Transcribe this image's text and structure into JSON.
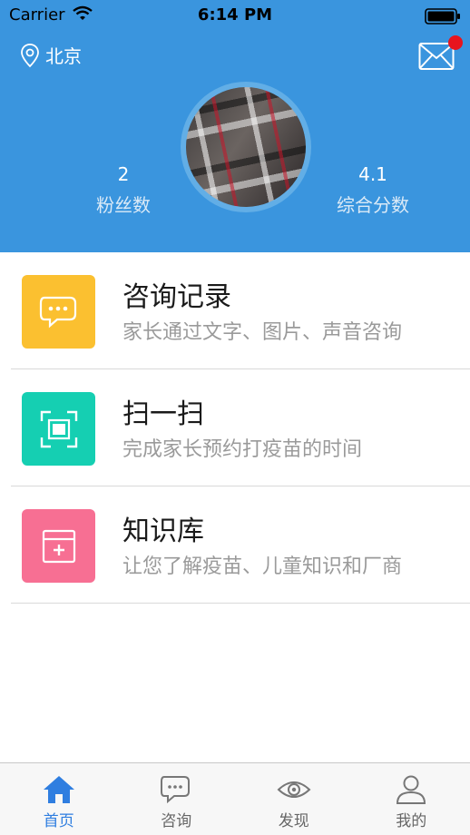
{
  "status_bar": {
    "carrier": "Carrier",
    "time": "6:14 PM"
  },
  "header": {
    "location": "北京",
    "stats": [
      {
        "value": "2",
        "label": "粉丝数"
      },
      {
        "value": "4.1",
        "label": "综合分数"
      }
    ]
  },
  "colors": {
    "header_bg": "#3a95de",
    "consult": "#fbc030",
    "scan": "#15cfb2",
    "knowledge": "#f76f93",
    "tab_active": "#2f7ee0"
  },
  "menu": [
    {
      "title": "咨询记录",
      "desc": "家长通过文字、图片、声音咨询",
      "icon": "chat-bubbles-icon"
    },
    {
      "title": "扫一扫",
      "desc": "完成家长预约打疫苗的时间",
      "icon": "scan-icon"
    },
    {
      "title": "知识库",
      "desc": "让您了解疫苗、儿童知识和厂商",
      "icon": "calendar-plus-icon"
    }
  ],
  "tabs": [
    {
      "label": "首页",
      "icon": "home-icon"
    },
    {
      "label": "咨询",
      "icon": "chat-icon"
    },
    {
      "label": "发现",
      "icon": "eye-icon"
    },
    {
      "label": "我的",
      "icon": "person-icon"
    }
  ]
}
